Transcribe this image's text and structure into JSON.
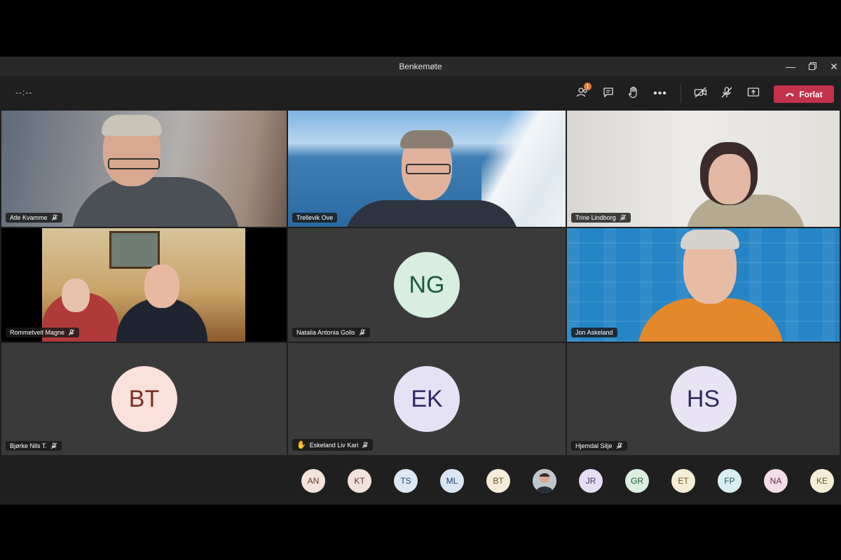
{
  "window": {
    "title": "Benkemøte"
  },
  "toolbar": {
    "timer": "--:--",
    "leave_label": "Forlat",
    "participants_badge": "1"
  },
  "tiles": [
    {
      "name": "Atle Kvamme",
      "initials": "",
      "avatar_bg": "",
      "avatar_fg": ""
    },
    {
      "name": "Trellevik Ove",
      "initials": "",
      "avatar_bg": "",
      "avatar_fg": ""
    },
    {
      "name": "Trine Lindborg",
      "initials": "",
      "avatar_bg": "",
      "avatar_fg": ""
    },
    {
      "name": "Rommetveit Magne",
      "initials": "",
      "avatar_bg": "",
      "avatar_fg": ""
    },
    {
      "name": "Natalia Antonia Golis",
      "initials": "NG",
      "avatar_bg": "#d7eee0",
      "avatar_fg": "#1e5a3a"
    },
    {
      "name": "Jon Askeland",
      "initials": "",
      "avatar_bg": "",
      "avatar_fg": ""
    },
    {
      "name": "Bjørke Nils T.",
      "initials": "BT",
      "avatar_bg": "#fbe1dc",
      "avatar_fg": "#7a2f22"
    },
    {
      "name": "Eskeland Liv Kari",
      "initials": "EK",
      "avatar_bg": "#e6e2f6",
      "avatar_fg": "#2f2966"
    },
    {
      "name": "Hjemdal Silje",
      "initials": "HS",
      "avatar_bg": "#e8e4f4",
      "avatar_fg": "#2e2a5e"
    }
  ],
  "tray": [
    {
      "initials": "AN",
      "bg": "#f3e3db",
      "fg": "#6b3a26"
    },
    {
      "initials": "KT",
      "bg": "#f1e2dc",
      "fg": "#5f352a"
    },
    {
      "initials": "TS",
      "bg": "#dbe8f4",
      "fg": "#1f4466"
    },
    {
      "initials": "ML",
      "bg": "#dbe6f4",
      "fg": "#203f6a"
    },
    {
      "initials": "BT",
      "bg": "#f4ecd9",
      "fg": "#6a5020"
    },
    {
      "initials": "",
      "bg": "#cfd4d8",
      "fg": "#333"
    },
    {
      "initials": "JR",
      "bg": "#e6def4",
      "fg": "#45306e"
    },
    {
      "initials": "GR",
      "bg": "#dbeedf",
      "fg": "#215a33"
    },
    {
      "initials": "ET",
      "bg": "#f5edd5",
      "fg": "#6a561c"
    },
    {
      "initials": "FP",
      "bg": "#d9eef2",
      "fg": "#1f5562"
    },
    {
      "initials": "NA",
      "bg": "#f3dde8",
      "fg": "#6b2d4a"
    },
    {
      "initials": "KE",
      "bg": "#f5eed6",
      "fg": "#6a571c"
    }
  ]
}
